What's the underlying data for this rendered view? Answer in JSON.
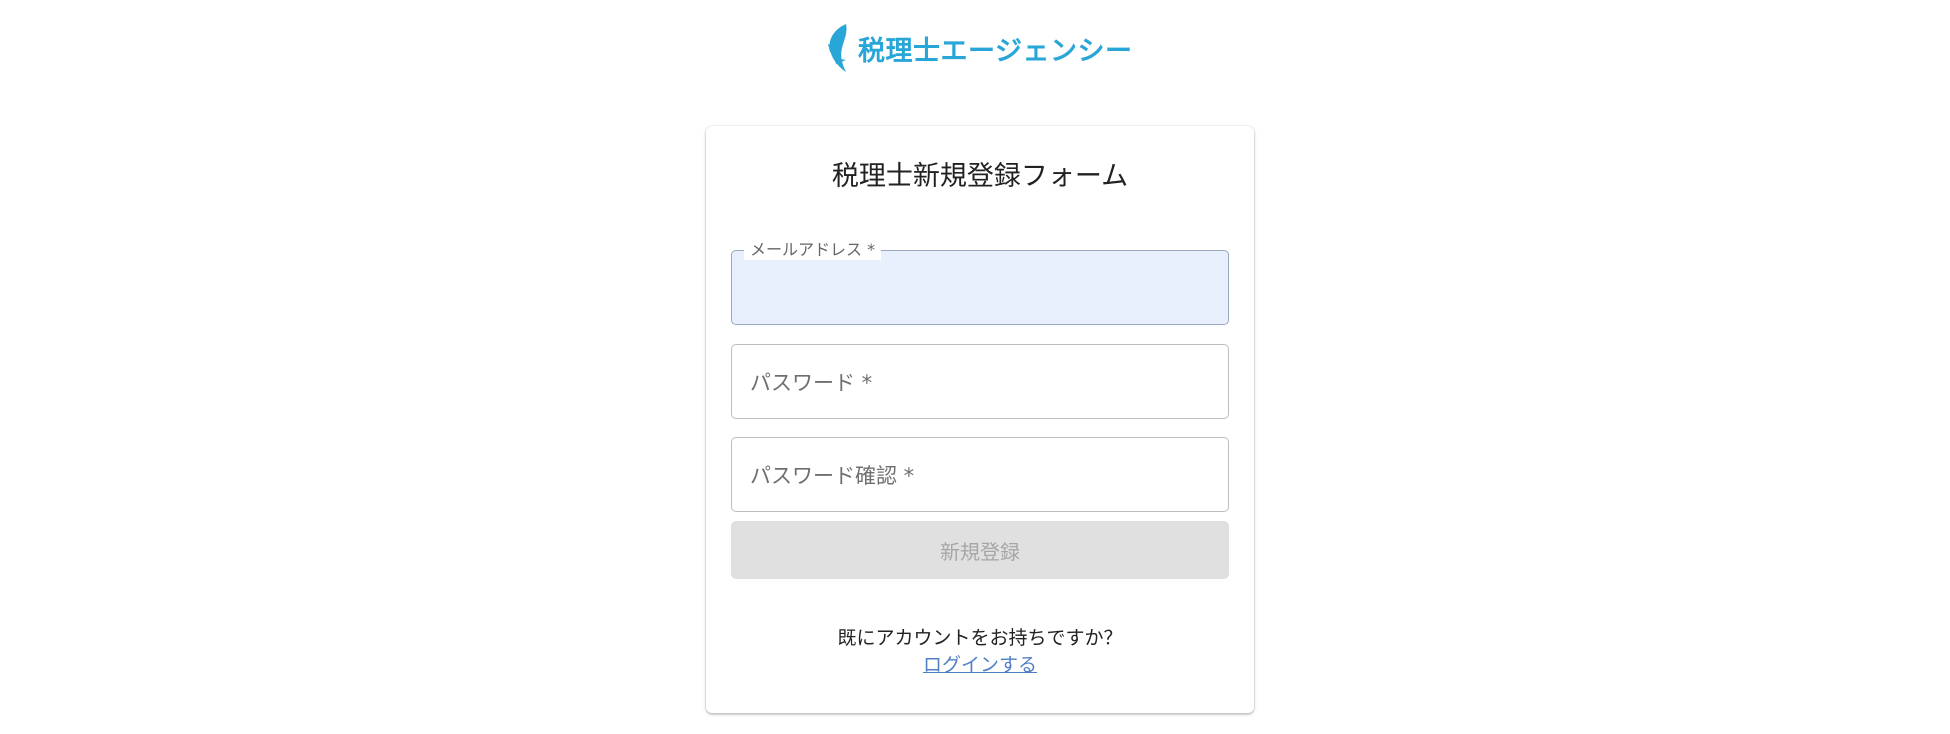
{
  "header": {
    "logo_text": "税理士エージェンシー",
    "logo_color": "#29a6d8"
  },
  "form": {
    "title": "税理士新規登録フォーム",
    "fields": [
      {
        "label": "メールアドレス *",
        "value": "",
        "filled": true
      },
      {
        "label": "パスワード *",
        "value": ""
      },
      {
        "label": "パスワード確認 *",
        "value": ""
      }
    ],
    "submit_label": "新規登録",
    "already_text": "既にアカウントをお持ちですか？",
    "login_link_text": "ログインする"
  }
}
